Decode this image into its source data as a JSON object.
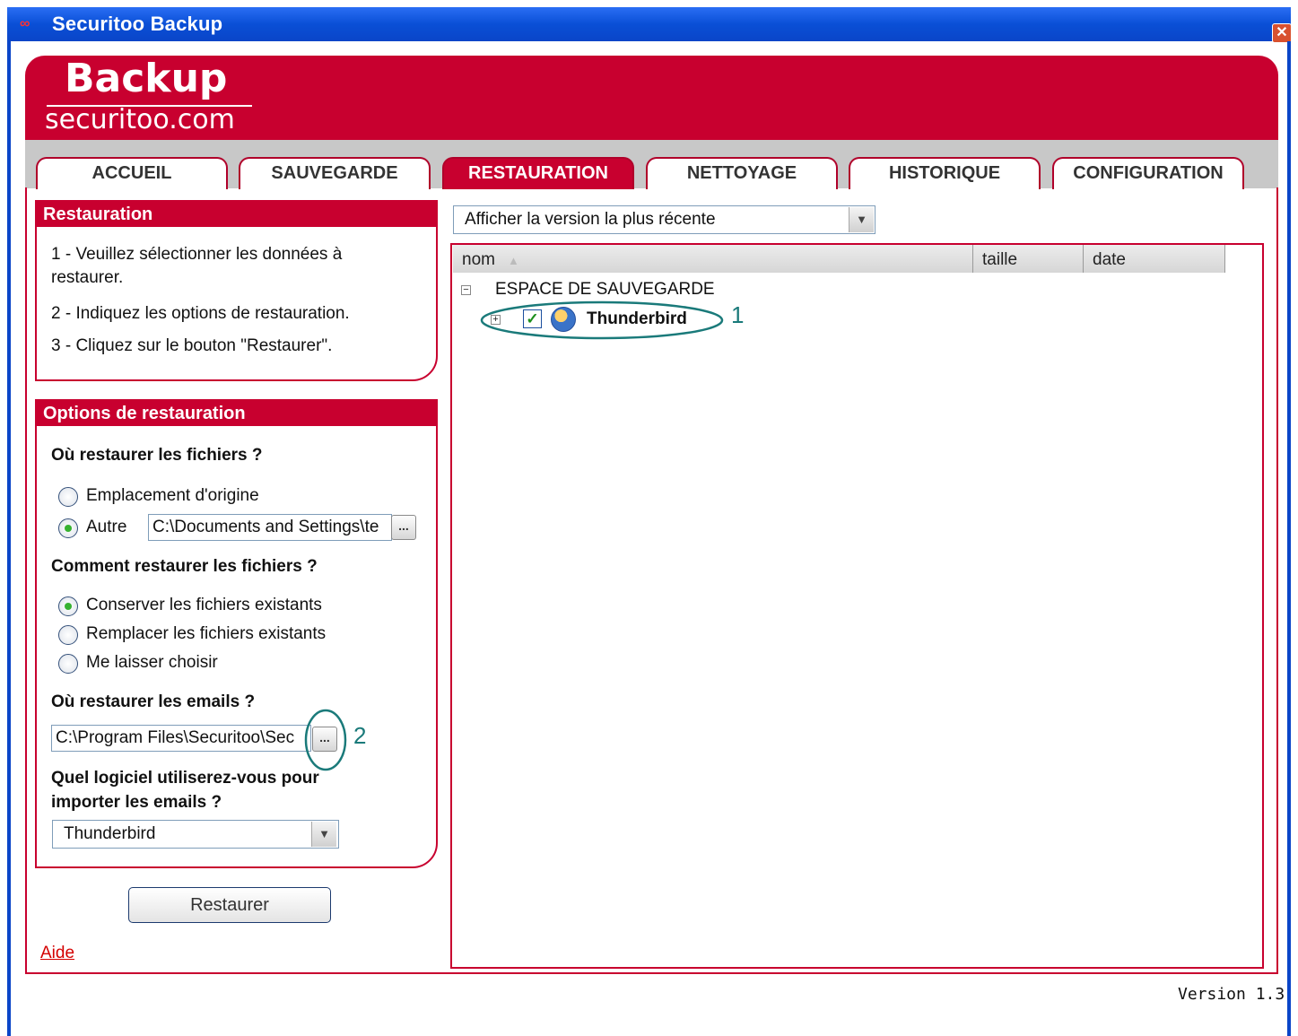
{
  "window": {
    "title": "Securitoo Backup",
    "icon": "securitoo-logo-icon",
    "close_icon": "close-icon"
  },
  "brand": {
    "name": "Backup",
    "site": "securitoo.com",
    "accent": "#c8002f"
  },
  "tabs": [
    {
      "label": "ACCUEIL",
      "active": false
    },
    {
      "label": "SAUVEGARDE",
      "active": false
    },
    {
      "label": "RESTAURATION",
      "active": true
    },
    {
      "label": "NETTOYAGE",
      "active": false
    },
    {
      "label": "HISTORIQUE",
      "active": false
    },
    {
      "label": "CONFIGURATION",
      "active": false
    }
  ],
  "restauration": {
    "title": "Restauration",
    "steps": [
      "1 - Veuillez sélectionner les données à",
      "restaurer.",
      "2 - Indiquez les options de restauration.",
      "3 - Cliquez sur le bouton \"Restaurer\"."
    ]
  },
  "options": {
    "title": "Options de restauration",
    "where_files": {
      "question": "Où restaurer les fichiers ?",
      "origin_label": "Emplacement d'origine",
      "other_label": "Autre",
      "other_path": "C:\\Documents and Settings\\te",
      "selected": "Autre"
    },
    "how_files": {
      "question": "Comment restaurer les fichiers ?",
      "choices": [
        "Conserver les fichiers existants",
        "Remplacer les fichiers existants",
        "Me laisser choisir"
      ],
      "selected": "Conserver les fichiers existants"
    },
    "where_emails": {
      "question": "Où restaurer les emails ?",
      "path": "C:\\Program Files\\Securitoo\\Sec"
    },
    "software": {
      "question_line1": "Quel logiciel utiliserez-vous pour",
      "question_line2": "importer les emails ?",
      "value": "Thunderbird"
    },
    "browse_label": "..."
  },
  "restore_button": "Restaurer",
  "help_link": "Aide",
  "version_select": "Afficher la version la plus récente",
  "columns": [
    "nom",
    "taille",
    "date"
  ],
  "tree": {
    "root": "ESPACE DE SAUVEGARDE",
    "child": "Thunderbird",
    "child_checked": true,
    "child_icon": "thunderbird-icon"
  },
  "annotations": [
    "1",
    "2"
  ],
  "footer": {
    "version": "Version 1.3"
  }
}
